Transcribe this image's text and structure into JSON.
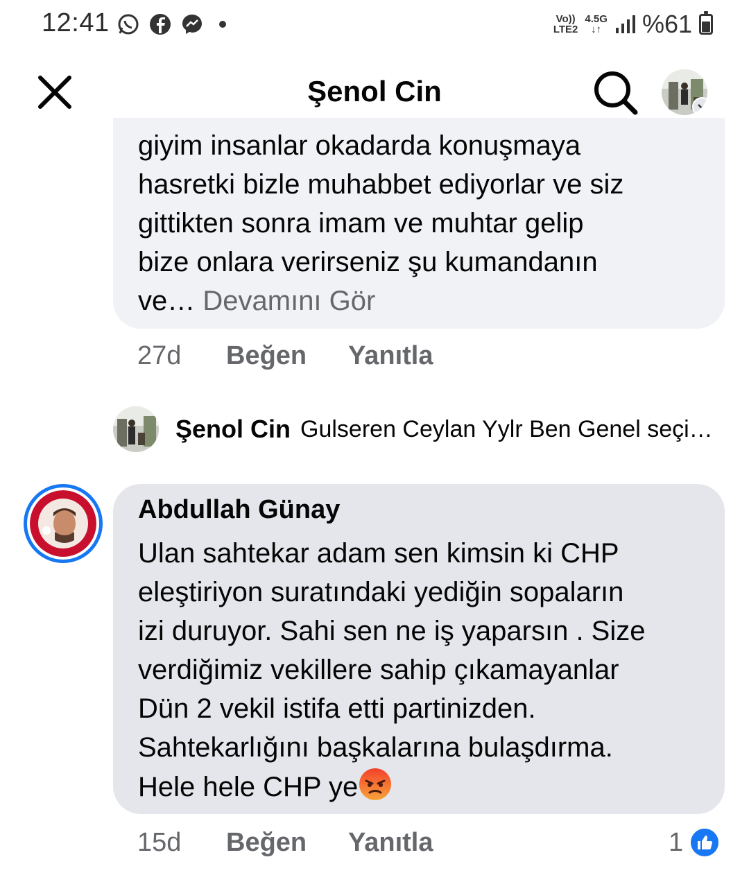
{
  "status": {
    "time": "12:41",
    "volte": "Vo))",
    "lte": "LTE2",
    "network": "4.5G",
    "battery": "%61",
    "battery_level": 0.61,
    "icons": [
      "whatsapp-icon",
      "facebook-icon",
      "messenger-icon"
    ]
  },
  "header": {
    "title": "Şenol Cin"
  },
  "comment1": {
    "lines": [
      "giyim insanlar okadarda konuşmaya",
      "hasretki bizle muhabbet ediyorlar  ve siz",
      "gittikten sonra imam ve muhtar gelip",
      "bize onlara verirseniz şu kumandanın"
    ],
    "last_line_start": "ve…",
    "see_more": "Devamını Gör",
    "time": "27d",
    "like_label": "Beğen",
    "reply_label": "Yanıtla"
  },
  "reply_preview": {
    "name": "Şenol Cin",
    "snippet": "Gulseren Ceylan Yylr Ben Genel seçi…"
  },
  "comment2": {
    "author": "Abdullah Günay",
    "lines": [
      "Ulan sahtekar adam sen kimsin ki CHP",
      "eleştiriyon  suratındaki yediğin sopaların",
      "izi duruyor. Sahi sen ne iş yaparsın . Size",
      "verdiğimiz vekillere sahip çıkamayanlar",
      "Dün 2 vekil istifa etti partinizden.",
      "Sahtekarlığını başkalarına bulaşdırma."
    ],
    "last_line": "Hele hele CHP ye",
    "time": "15d",
    "like_label": "Beğen",
    "reply_label": "Yanıtla",
    "reaction_count": "1"
  },
  "colors": {
    "bubble": "#f0f2f5",
    "bubble_dark": "#e4e6eb",
    "meta": "#65676b",
    "accent": "#1877f2"
  }
}
